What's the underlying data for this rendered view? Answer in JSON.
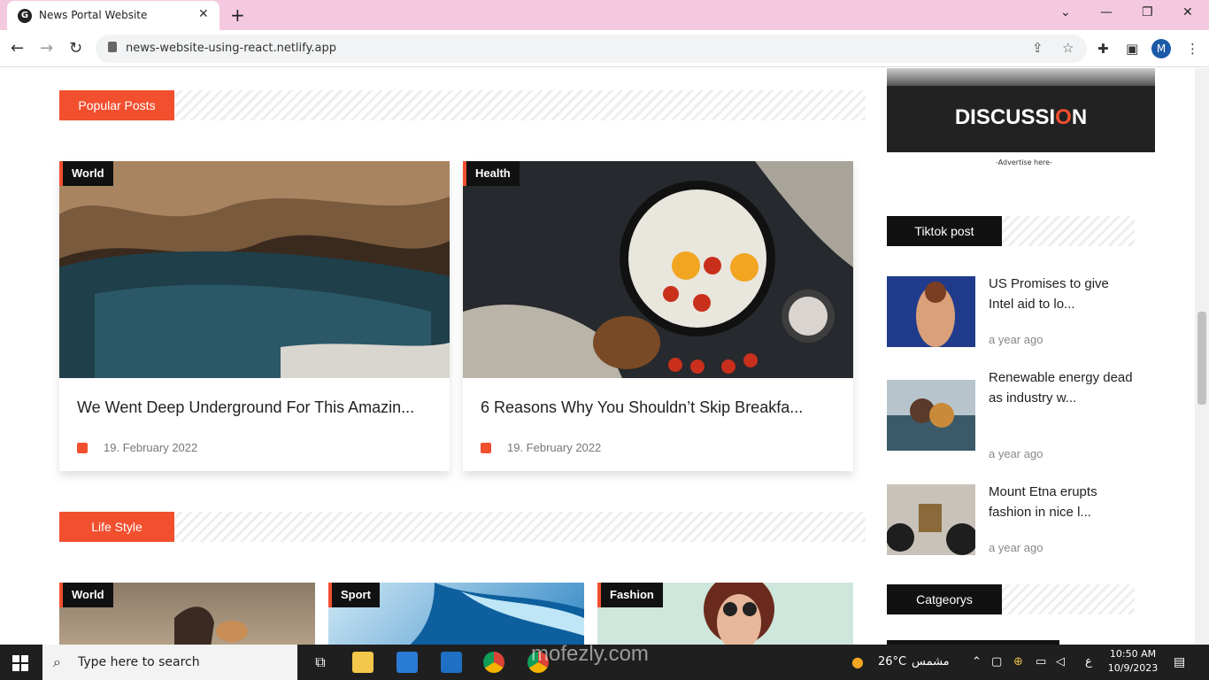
{
  "browser": {
    "tab_title": "News Portal Website",
    "url": "news-website-using-react.netlify.app",
    "avatar_letter": "M"
  },
  "main": {
    "popular": {
      "label": "Popular Posts",
      "cards": [
        {
          "category": "World",
          "title": "We Went Deep Underground For This Amazin...",
          "date": "19. February 2022"
        },
        {
          "category": "Health",
          "title": "6 Reasons Why You Shouldn’t Skip Breakfa...",
          "date": "19. February 2022"
        }
      ]
    },
    "lifestyle": {
      "label": "Life Style",
      "cards": [
        {
          "category": "World"
        },
        {
          "category": "Sport"
        },
        {
          "category": "Fashion"
        }
      ]
    }
  },
  "sidebar": {
    "ad_text_pre": "DISCUSSI",
    "ad_text_o": "O",
    "ad_text_post": "N",
    "ad_caption": "-Advertise here-",
    "tiktok_label": "Tiktok post",
    "tiktok_posts": [
      {
        "title": "US Promises to give Intel aid to lo...",
        "time": "a year ago"
      },
      {
        "title": "Renewable energy dead as industry w...",
        "time": "a year ago"
      },
      {
        "title": "Mount Etna erupts fashion in nice l...",
        "time": "a year ago"
      }
    ],
    "categories_label": "Catgeorys"
  },
  "taskbar": {
    "search_placeholder": "Type here to search",
    "weather": "26°C",
    "weather_label": "مشمس",
    "lang": "ع",
    "time": "10:50 AM",
    "date": "10/9/2023",
    "watermark": "mofezly.com"
  }
}
